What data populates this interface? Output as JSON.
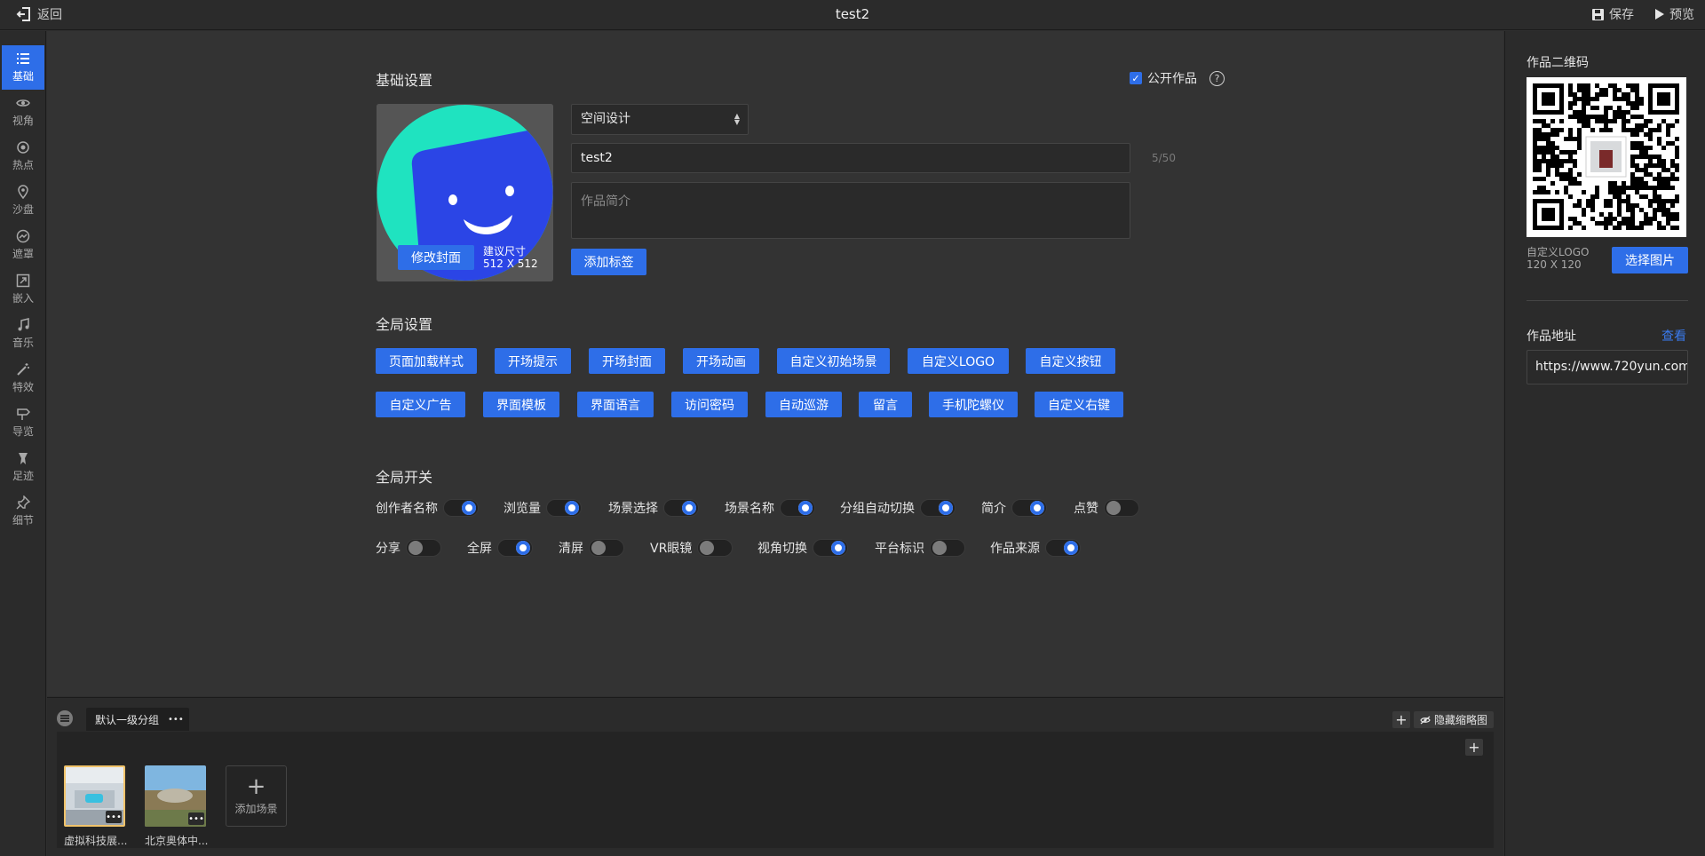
{
  "header": {
    "back_label": "返回",
    "title": "test2",
    "save_label": "保存",
    "preview_label": "预览"
  },
  "leftnav": {
    "items": [
      {
        "label": "基础",
        "icon": "list-icon",
        "active": true
      },
      {
        "label": "视角",
        "icon": "eye-icon"
      },
      {
        "label": "热点",
        "icon": "target-icon"
      },
      {
        "label": "沙盘",
        "icon": "map-pin-icon"
      },
      {
        "label": "遮罩",
        "icon": "mask-icon"
      },
      {
        "label": "嵌入",
        "icon": "embed-icon"
      },
      {
        "label": "音乐",
        "icon": "music-icon"
      },
      {
        "label": "特效",
        "icon": "magic-wand-icon"
      },
      {
        "label": "导览",
        "icon": "signpost-icon"
      },
      {
        "label": "足迹",
        "icon": "footprint-icon"
      },
      {
        "label": "细节",
        "icon": "pushpin-icon"
      }
    ]
  },
  "basic": {
    "title": "基础设置",
    "public_label": "公开作品",
    "public_checked": true,
    "cover_button": "修改封面",
    "cover_hint_1": "建议尺寸",
    "cover_hint_2": "512 X 512",
    "category": "空间设计",
    "name_value": "test2",
    "name_counter": "5/50",
    "intro_placeholder": "作品简介",
    "add_tag": "添加标签"
  },
  "global_settings": {
    "title": "全局设置",
    "row1": [
      "页面加载样式",
      "开场提示",
      "开场封面",
      "开场动画",
      "自定义初始场景",
      "自定义LOGO",
      "自定义按钮"
    ],
    "row2": [
      "自定义广告",
      "界面模板",
      "界面语言",
      "访问密码",
      "自动巡游",
      "留言",
      "手机陀螺仪",
      "自定义右键"
    ]
  },
  "global_switches": {
    "title": "全局开关",
    "row1": [
      {
        "label": "创作者名称",
        "on": true
      },
      {
        "label": "浏览量",
        "on": true
      },
      {
        "label": "场景选择",
        "on": true
      },
      {
        "label": "场景名称",
        "on": true
      },
      {
        "label": "分组自动切换",
        "on": true
      },
      {
        "label": "简介",
        "on": true
      },
      {
        "label": "点赞",
        "on": false
      }
    ],
    "row2": [
      {
        "label": "分享",
        "on": false
      },
      {
        "label": "全屏",
        "on": true
      },
      {
        "label": "清屏",
        "on": false
      },
      {
        "label": "VR眼镜",
        "on": false
      },
      {
        "label": "视角切换",
        "on": true
      },
      {
        "label": "平台标识",
        "on": false
      },
      {
        "label": "作品来源",
        "on": true
      }
    ]
  },
  "right_panel": {
    "qr_title": "作品二维码",
    "logo_hint_1": "自定义LOGO",
    "logo_hint_2": "120 X 120",
    "choose_image": "选择图片",
    "address_title": "作品地址",
    "view_link": "查看",
    "url_value": "https://www.720yun.com"
  },
  "bottom": {
    "group_name": "默认一级分组",
    "group_more": "•••",
    "hide_thumbnails": "隐藏缩略图",
    "add_scene": "添加场景",
    "scenes": [
      {
        "label": "虚拟科技展...",
        "selected": true
      },
      {
        "label": "北京奥体中...",
        "selected": false
      }
    ]
  },
  "colors": {
    "accent": "#2e6ee8",
    "background": "#333333",
    "panel": "#2b2b2b"
  }
}
